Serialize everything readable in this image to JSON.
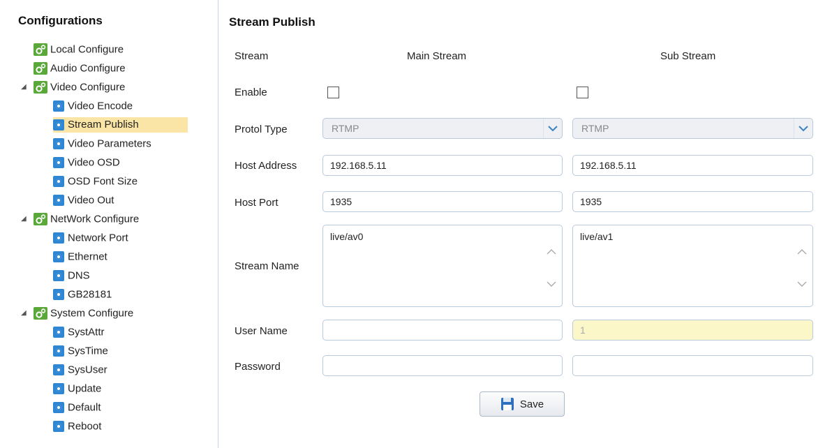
{
  "sidebar": {
    "title": "Configurations",
    "items": [
      {
        "label": "Local Configure"
      },
      {
        "label": "Audio Configure"
      },
      {
        "label": "Video Configure",
        "expanded": true,
        "children": [
          {
            "label": "Video Encode"
          },
          {
            "label": "Stream Publish",
            "selected": true
          },
          {
            "label": "Video Parameters"
          },
          {
            "label": "Video OSD"
          },
          {
            "label": "OSD Font Size"
          },
          {
            "label": "Video Out"
          }
        ]
      },
      {
        "label": "NetWork Configure",
        "expanded": true,
        "children": [
          {
            "label": "Network Port"
          },
          {
            "label": "Ethernet"
          },
          {
            "label": "DNS"
          },
          {
            "label": "GB28181"
          }
        ]
      },
      {
        "label": "System Configure",
        "expanded": true,
        "children": [
          {
            "label": "SystAttr"
          },
          {
            "label": "SysTime"
          },
          {
            "label": "SysUser"
          },
          {
            "label": "Update"
          },
          {
            "label": "Default"
          },
          {
            "label": "Reboot"
          }
        ]
      }
    ]
  },
  "main": {
    "title": "Stream Publish",
    "labels": {
      "stream": "Stream",
      "enable": "Enable",
      "protocol_type": "Protol Type",
      "host_address": "Host Address",
      "host_port": "Host Port",
      "stream_name": "Stream Name",
      "user_name": "User Name",
      "password": "Password"
    },
    "main_stream": {
      "header": "Main Stream",
      "enabled": false,
      "protocol": "RTMP",
      "host_address": "192.168.5.11",
      "host_port": "1935",
      "stream_name": "live/av0",
      "user_name": "",
      "password": ""
    },
    "sub_stream": {
      "header": "Sub Stream",
      "enabled": false,
      "protocol": "RTMP",
      "host_address": "192.168.5.11",
      "host_port": "1935",
      "stream_name": "live/av1",
      "user_name": "1",
      "password": ""
    },
    "save_label": "Save"
  },
  "colors": {
    "selected_highlight": "#fbe5a6",
    "input_border": "#b9c9de",
    "yellow_field": "#fbf7c9",
    "icon_blue": "#2f87d3",
    "icon_green": "#5aa83a"
  }
}
